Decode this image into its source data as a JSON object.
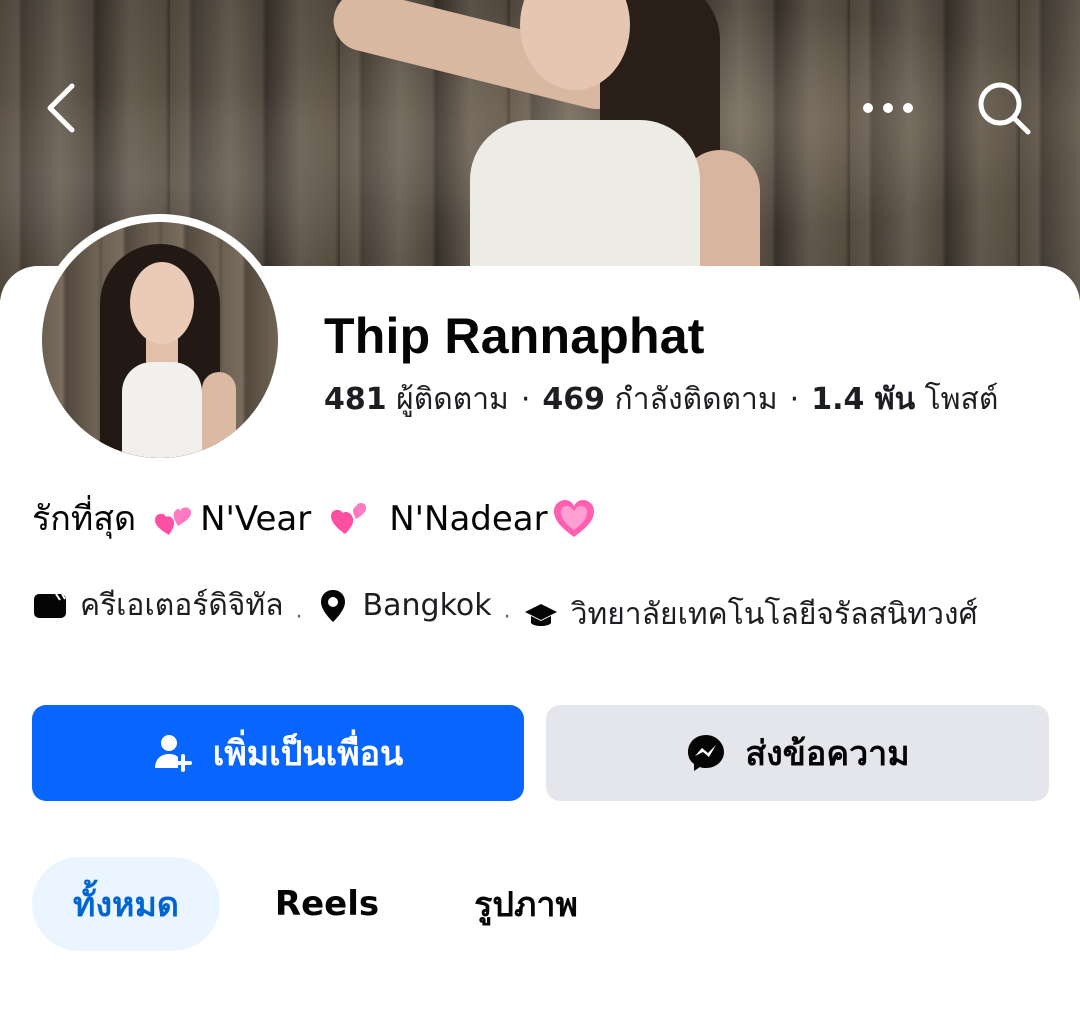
{
  "header": {
    "back_icon": "chevron-left-icon",
    "more_icon": "ellipsis-icon",
    "search_icon": "search-icon"
  },
  "profile": {
    "name": "Thip Rannaphat",
    "stats": {
      "followers_count": "481",
      "followers_label": "ผู้ติดตาม",
      "following_count": "469",
      "following_label": "กำลังติดตาม",
      "posts_count": "1.4 พัน",
      "posts_label": "โพสต์"
    },
    "bio": {
      "prefix": "รักที่สุด",
      "name1": "N'Vear",
      "name2": "N'Nadear"
    },
    "details": {
      "category": "ครีเอเตอร์ดิจิทัล",
      "location": "Bangkok",
      "education": "วิทยาลัยเทคโนโลยีจรัลสนิทวงศ์"
    }
  },
  "actions": {
    "add_friend": "เพิ่มเป็นเพื่อน",
    "message": "ส่งข้อความ"
  },
  "tabs": [
    {
      "label": "ทั้งหมด",
      "active": true
    },
    {
      "label": "Reels",
      "active": false
    },
    {
      "label": "รูปภาพ",
      "active": false
    }
  ],
  "colors": {
    "primary": "#0866ff",
    "secondary_button": "#e4e6eb",
    "active_tab_bg": "#ebf5ff",
    "active_tab_text": "#0064d1",
    "heart": "#ff4fa3"
  }
}
